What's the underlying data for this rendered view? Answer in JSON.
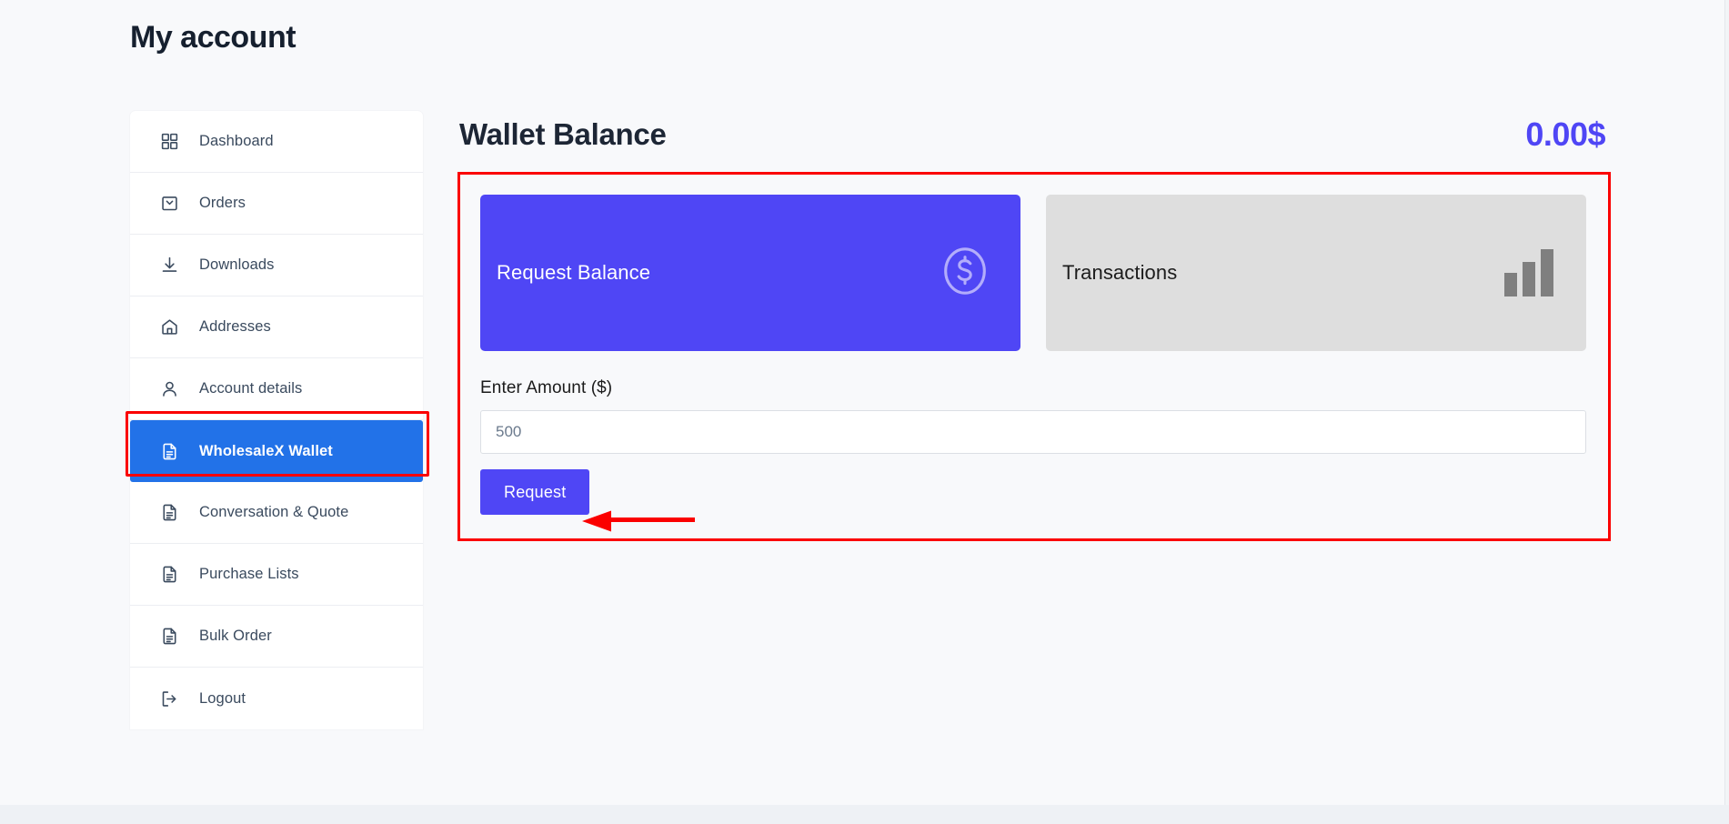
{
  "page": {
    "title": "My account",
    "background_color": "#f8f9fb"
  },
  "sidebar": {
    "items": [
      {
        "label": "Dashboard",
        "icon": "grid-icon",
        "active": false
      },
      {
        "label": "Orders",
        "icon": "bag-icon",
        "active": false
      },
      {
        "label": "Downloads",
        "icon": "download-icon",
        "active": false
      },
      {
        "label": "Addresses",
        "icon": "home-icon",
        "active": false
      },
      {
        "label": "Account details",
        "icon": "user-icon",
        "active": false
      },
      {
        "label": "WholesaleX Wallet",
        "icon": "document-icon",
        "active": true
      },
      {
        "label": "Conversation & Quote",
        "icon": "document-icon",
        "active": false
      },
      {
        "label": "Purchase Lists",
        "icon": "document-icon",
        "active": false
      },
      {
        "label": "Bulk Order",
        "icon": "document-icon",
        "active": false
      },
      {
        "label": "Logout",
        "icon": "logout-icon",
        "active": false
      }
    ],
    "active_color": "#2272e8"
  },
  "wallet": {
    "heading": "Wallet Balance",
    "balance": "0.00$",
    "balance_color": "#4f46f5",
    "cards": [
      {
        "label": "Request Balance",
        "icon": "dollar-circle-icon",
        "background": "#4f46f5",
        "text_color": "#ffffff"
      },
      {
        "label": "Transactions",
        "icon": "bar-chart-icon",
        "background": "#dedede",
        "text_color": "#1c1c1c"
      }
    ],
    "form": {
      "amount_label": "Enter Amount ($)",
      "amount_value": "",
      "amount_placeholder": "500",
      "submit_label": "Request"
    }
  },
  "annotations": {
    "highlight_color": "#fb0000",
    "targets": [
      "sidebar-item-wholesalex-wallet",
      "wallet-panel",
      "request-button"
    ]
  }
}
